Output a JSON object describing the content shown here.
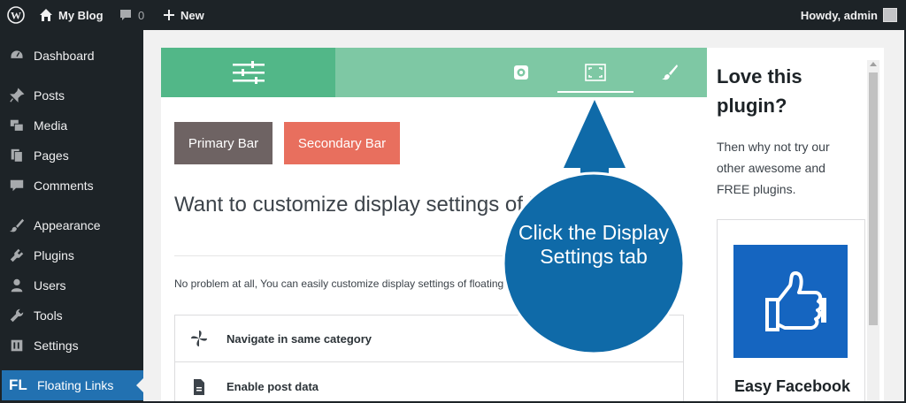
{
  "adminbar": {
    "site_name": "My Blog",
    "comments_count": "0",
    "new_label": "New",
    "howdy": "Howdy, admin"
  },
  "sidebar": {
    "items": [
      {
        "label": "Dashboard",
        "icon": "dashboard-icon"
      },
      {
        "label": "Posts",
        "icon": "pin-icon"
      },
      {
        "label": "Media",
        "icon": "media-icon"
      },
      {
        "label": "Pages",
        "icon": "pages-icon"
      },
      {
        "label": "Comments",
        "icon": "comment-icon"
      },
      {
        "label": "Appearance",
        "icon": "brush-icon"
      },
      {
        "label": "Plugins",
        "icon": "plugin-icon"
      },
      {
        "label": "Users",
        "icon": "user-icon"
      },
      {
        "label": "Tools",
        "icon": "wrench-icon"
      },
      {
        "label": "Settings",
        "icon": "settings-icon"
      }
    ],
    "active": {
      "badge": "FL",
      "label": "Floating Links"
    }
  },
  "panel": {
    "tabs": [
      {
        "name": "bars",
        "icon": "sliders-icon"
      },
      {
        "name": "settings",
        "icon": "gear-icon"
      },
      {
        "name": "display",
        "icon": "display-frame-icon"
      },
      {
        "name": "style",
        "icon": "paintbrush-icon"
      }
    ],
    "primary_bar": "Primary Bar",
    "secondary_bar": "Secondary Bar",
    "heading": "Want to customize display settings of Floating bar?",
    "description": "No problem at all, You can easily customize display settings of floating bar.",
    "options": [
      {
        "label": "Navigate in same category",
        "icon": "pinwheel-icon"
      },
      {
        "label": "Enable post data",
        "icon": "document-icon"
      }
    ]
  },
  "promo": {
    "title": "Love this plugin?",
    "text": "Then why not try our other awesome and FREE plugins.",
    "card_title": "Easy Facebook",
    "card_icon": "thumbs-up-icon"
  },
  "callout": {
    "text": "Click the Display Settings tab"
  },
  "colors": {
    "admin_dark": "#1d2327",
    "active_blue": "#2271b1",
    "tab_green": "#52b788",
    "tab_light_green": "#7ec8a4",
    "primary_bar": "#6e6363",
    "secondary_bar": "#e86f5e",
    "callout_blue": "#0f6aa8"
  }
}
